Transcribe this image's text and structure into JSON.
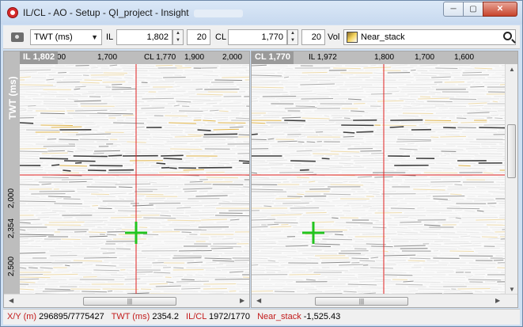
{
  "window": {
    "title": "IL/CL - AO - Setup - QI_project - Insight",
    "min_glyph": "─",
    "max_glyph": "▢",
    "close_glyph": "✕"
  },
  "toolbar": {
    "domain_select": "TWT (ms)",
    "il_label": "IL",
    "il_value": "1,802",
    "il_step": "20",
    "cl_label": "CL",
    "cl_value": "1,770",
    "cl_step": "20",
    "vol_label": "Vol",
    "vol_name": "Near_stack"
  },
  "left_panel": {
    "tag": "IL 1,802",
    "top_ticks": [
      "1,600",
      "1,700",
      "CL 1,770",
      "1,900",
      "2,000"
    ],
    "axis_name": "TWT (ms)",
    "left_ticks": [
      "2,000",
      "2,354",
      "2,500"
    ]
  },
  "right_panel": {
    "tag": "CL 1,770",
    "top_ticks": [
      "IL 1,972",
      "1,800",
      "1,700",
      "1,600"
    ]
  },
  "status": {
    "xy_key": "X/Y (m)",
    "xy_val": "296895/7775427",
    "twt_key": "TWT (ms)",
    "twt_val": "2354.2",
    "ilcl_key": "IL/CL",
    "ilcl_val": "1972/1770",
    "vol_key": "Near_stack",
    "vol_val": "-1,525.43"
  },
  "colors": {
    "crosshair": "#e02020",
    "cursor": "#22c41e",
    "reflector_dark": "#1a1a1a",
    "reflector_gold": "#d9a31b"
  }
}
